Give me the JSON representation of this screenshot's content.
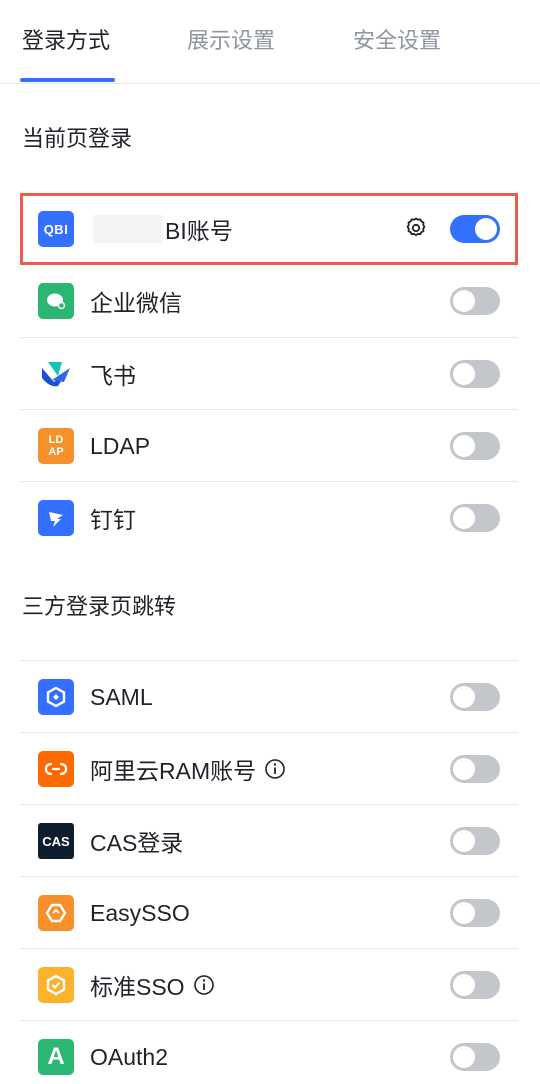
{
  "tabs": {
    "login_method": "登录方式",
    "display_settings": "展示设置",
    "security_settings": "安全设置"
  },
  "current_page_login": {
    "title": "当前页登录",
    "items": [
      {
        "label": "BI账号",
        "logo_text": "QBI",
        "logo_color": "#3370ff",
        "enabled": true
      },
      {
        "label": "企业微信",
        "logo_color": "#2bb673",
        "enabled": false
      },
      {
        "label": "飞书",
        "enabled": false
      },
      {
        "label": "LDAP",
        "logo_text": "LD\nAP",
        "logo_color": "#f5902b",
        "enabled": false
      },
      {
        "label": "钉钉",
        "logo_color": "#3370ff",
        "enabled": false
      }
    ]
  },
  "third_party_redirect": {
    "title": "三方登录页跳转",
    "items": [
      {
        "label": "SAML",
        "logo_color": "#3370ff",
        "enabled": false
      },
      {
        "label": "阿里云RAM账号",
        "logo_color": "#ff6a00",
        "enabled": false,
        "info": true
      },
      {
        "label": "CAS登录",
        "logo_text": "CAS",
        "logo_color": "#0f1e2e",
        "enabled": false
      },
      {
        "label": "EasySSO",
        "logo_color": "#f5902b",
        "enabled": false
      },
      {
        "label": "标准SSO",
        "logo_color": "#fbb22d",
        "enabled": false,
        "info": true
      },
      {
        "label": "OAuth2",
        "logo_text": "A",
        "logo_color": "#2bb673",
        "enabled": false
      }
    ]
  },
  "colors": {
    "accent": "#3370ff",
    "highlight_border": "#ef5a50",
    "switch_off": "#c3c6cb"
  }
}
